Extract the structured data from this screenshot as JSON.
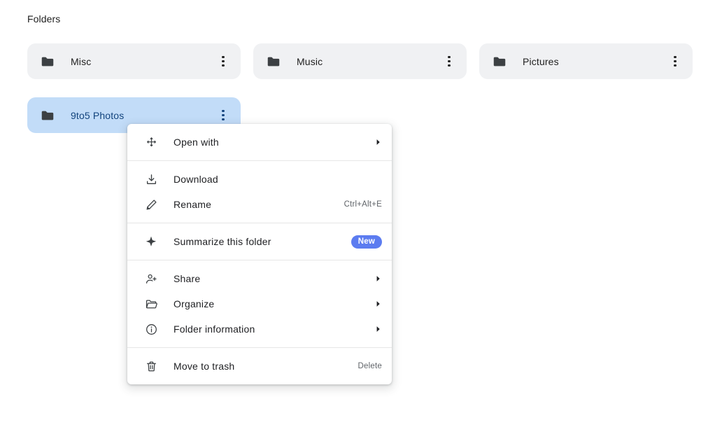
{
  "section": {
    "title": "Folders"
  },
  "folders": [
    {
      "name": "Misc",
      "icon": "folder-icon",
      "selected": false
    },
    {
      "name": "Music",
      "icon": "folder-icon",
      "selected": false
    },
    {
      "name": "Pictures",
      "icon": "folder-icon",
      "selected": false
    },
    {
      "name": "9to5 Photos",
      "icon": "folder-icon",
      "selected": true
    }
  ],
  "context_menu": {
    "groups": [
      {
        "items": [
          {
            "label": "Open with",
            "icon": "move-arrows-icon",
            "submenu": true,
            "shortcut": "",
            "badge": ""
          }
        ]
      },
      {
        "items": [
          {
            "label": "Download",
            "icon": "download-icon",
            "submenu": false,
            "shortcut": "",
            "badge": ""
          },
          {
            "label": "Rename",
            "icon": "pencil-icon",
            "submenu": false,
            "shortcut": "Ctrl+Alt+E",
            "badge": ""
          }
        ]
      },
      {
        "items": [
          {
            "label": "Summarize this folder",
            "icon": "sparkle-icon",
            "submenu": false,
            "shortcut": "",
            "badge": "New"
          }
        ]
      },
      {
        "items": [
          {
            "label": "Share",
            "icon": "person-add-icon",
            "submenu": true,
            "shortcut": "",
            "badge": ""
          },
          {
            "label": "Organize",
            "icon": "open-folder-icon",
            "submenu": true,
            "shortcut": "",
            "badge": ""
          },
          {
            "label": "Folder information",
            "icon": "info-circle-icon",
            "submenu": true,
            "shortcut": "",
            "badge": ""
          }
        ]
      },
      {
        "items": [
          {
            "label": "Move to trash",
            "icon": "trash-icon",
            "submenu": false,
            "shortcut": "Delete",
            "badge": ""
          }
        ]
      }
    ]
  },
  "colors": {
    "card_background": "#f0f1f3",
    "card_selected_background": "#c2dcf8",
    "card_selected_text": "#13447e",
    "text_primary": "#1f1f1f",
    "text_secondary": "#5f6368",
    "badge_new": "#5c7cf0",
    "menu_background": "#ffffff",
    "divider": "#e6e6e6"
  }
}
